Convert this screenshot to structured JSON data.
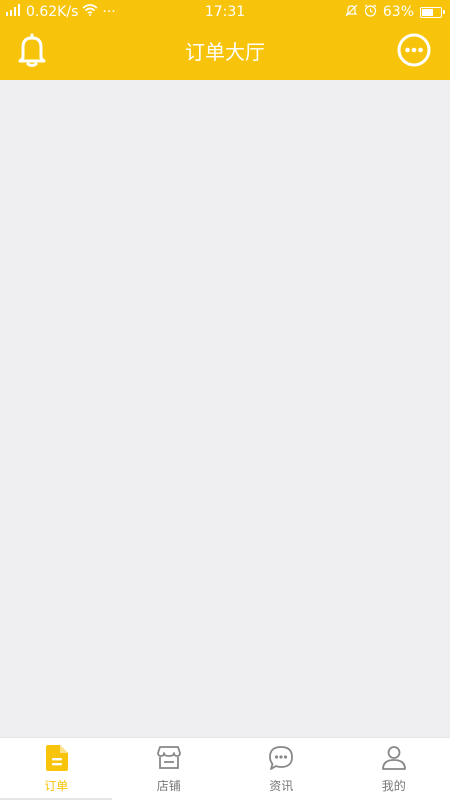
{
  "status_bar": {
    "network_speed": "0.62K/s",
    "more": "···",
    "time": "17:31",
    "battery_percent": "63%",
    "battery_level": 0.63
  },
  "header": {
    "title": "订单大厅",
    "left_icon": "bell-icon",
    "right_icon": "more-icon"
  },
  "tabbar": {
    "active_color": "#f8c40b",
    "inactive_color": "#777777",
    "items": [
      {
        "label": "订单",
        "icon": "order-document-icon",
        "active": true
      },
      {
        "label": "店铺",
        "icon": "store-icon",
        "active": false
      },
      {
        "label": "资讯",
        "icon": "chat-bubble-icon",
        "active": false
      },
      {
        "label": "我的",
        "icon": "user-icon",
        "active": false
      }
    ]
  },
  "colors": {
    "accent": "#f8c40b",
    "background": "#efeef1"
  }
}
